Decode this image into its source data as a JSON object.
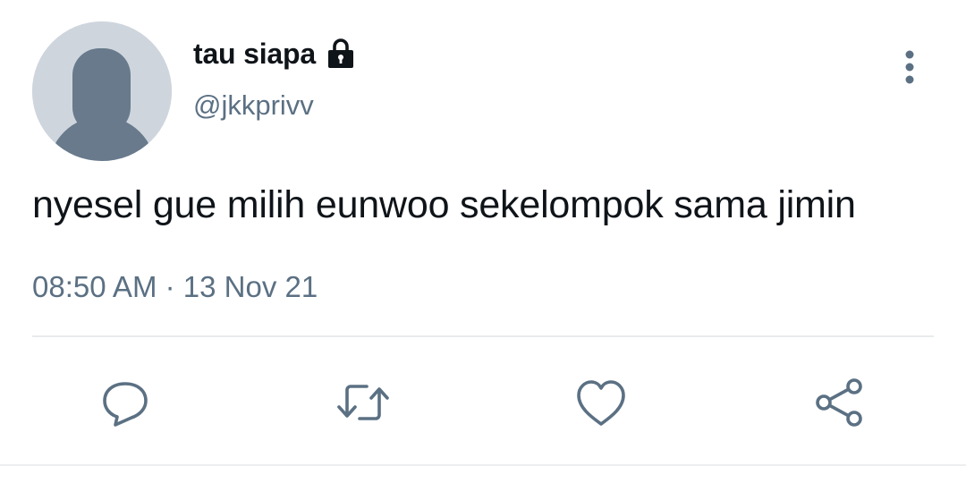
{
  "tweet": {
    "display_name": "tau siapa",
    "handle": "@jkkprivv",
    "text": "nyesel gue milih eunwoo sekelompok sama jimin",
    "timestamp": "08:50 AM · 13 Nov 21",
    "protected": true
  },
  "icons": {
    "avatar": "default-avatar",
    "lock": "lock-icon",
    "more": "more-vertical-icon",
    "actions": [
      "reply-icon",
      "retweet-icon",
      "like-icon",
      "share-icon"
    ]
  },
  "colors": {
    "text_primary": "#0f1419",
    "text_secondary": "#5b7083",
    "avatar_bg": "#ced5dd",
    "avatar_fg": "#687a8c",
    "divider": "#e8ebee"
  }
}
